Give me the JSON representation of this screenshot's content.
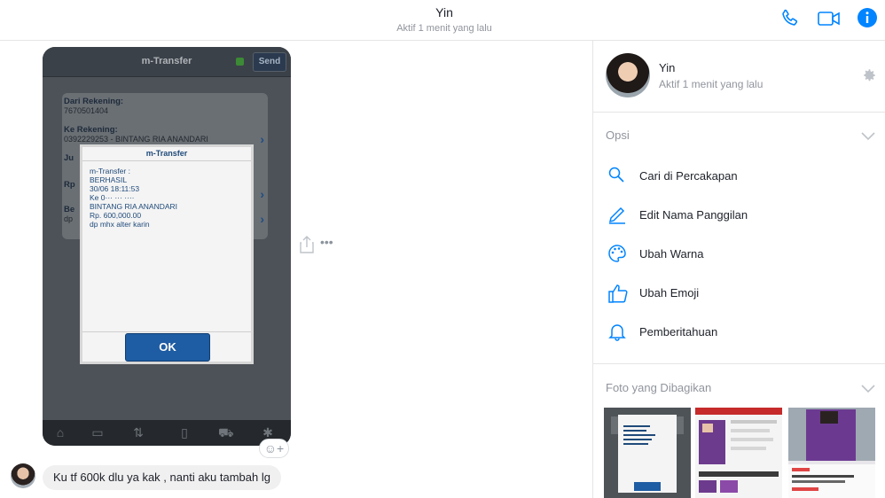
{
  "header": {
    "name": "Yin",
    "status": "Aktif 1 menit yang lalu"
  },
  "photo": {
    "app_title": "m-Transfer",
    "send_label": "Send",
    "fields": [
      {
        "label": "Dari Rekening:",
        "value": "7670501404"
      },
      {
        "label": "Ke Rekening:",
        "value": "0392229253 - BINTANG RIA ANANDARI"
      },
      {
        "label": "Ju",
        "value": ""
      },
      {
        "label": "Rp",
        "value": ""
      },
      {
        "label": "Be",
        "value": "dp"
      }
    ],
    "dialog": {
      "title": "m-Transfer",
      "lines": [
        "m-Transfer :",
        "BERHASIL",
        "30/06 18:11:53",
        "Ke 0··· ··· ····",
        "BINTANG RIA ANANDARI",
        "Rp. 600,000.00",
        "dp mhx alter karin"
      ],
      "ok_label": "OK"
    }
  },
  "message": {
    "text": "Ku tf 600k dlu ya kak , nanti aku tambah lg"
  },
  "panel": {
    "name": "Yin",
    "status": "Aktif 1 menit yang lalu",
    "options_title": "Opsi",
    "options": [
      {
        "label": "Cari di Percakapan",
        "icon": "search-icon"
      },
      {
        "label": "Edit Nama Panggilan",
        "icon": "pencil-icon"
      },
      {
        "label": "Ubah Warna",
        "icon": "palette-icon"
      },
      {
        "label": "Ubah Emoji",
        "icon": "thumbs-up-icon"
      },
      {
        "label": "Pemberitahuan",
        "icon": "bell-icon"
      }
    ],
    "shared_title": "Foto yang Dibagikan"
  },
  "colors": {
    "accent": "#0084ff",
    "bubble": "#f1f0f0",
    "muted": "#90949c"
  }
}
